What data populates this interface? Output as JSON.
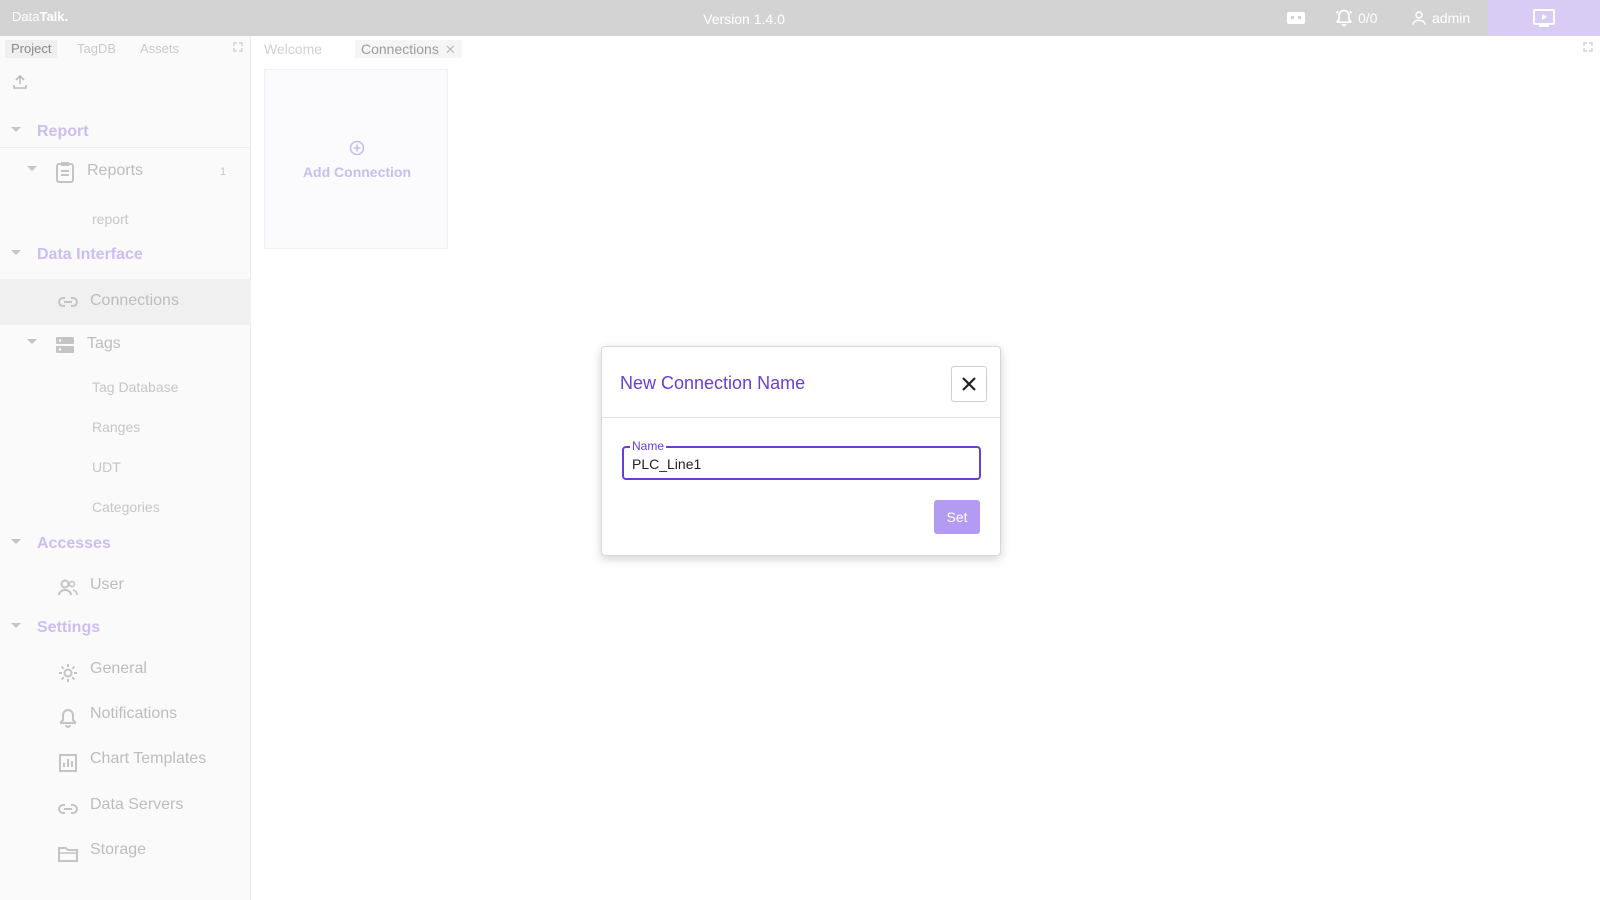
{
  "header": {
    "brand_regular": "Data",
    "brand_bold": "Talk.",
    "version": "Version 1.4.0",
    "alarm_count": "0/0",
    "user": "admin"
  },
  "sidebar": {
    "tabs": [
      "Project",
      "TagDB",
      "Assets"
    ],
    "groups": {
      "report": "Report",
      "data_interface": "Data Interface",
      "accesses": "Accesses",
      "settings": "Settings"
    },
    "items": {
      "reports": "Reports",
      "reports_badge": "1",
      "report": "report",
      "connections": "Connections",
      "tags": "Tags",
      "tag_database": "Tag Database",
      "ranges": "Ranges",
      "udt": "UDT",
      "categories": "Categories",
      "user": "User",
      "general": "General",
      "notifications": "Notifications",
      "chart_templates": "Chart Templates",
      "data_servers": "Data Servers",
      "storage": "Storage"
    }
  },
  "main": {
    "tabs": [
      "Welcome",
      "Connections"
    ],
    "add_connection": "Add Connection"
  },
  "dialog": {
    "title": "New Connection Name",
    "field_label": "Name",
    "field_value": "PLC_Line1",
    "set_label": "Set"
  },
  "colors": {
    "accent": "#6a3ed6",
    "accent_light": "#b39af3",
    "topbar": "#d3d3d3"
  }
}
